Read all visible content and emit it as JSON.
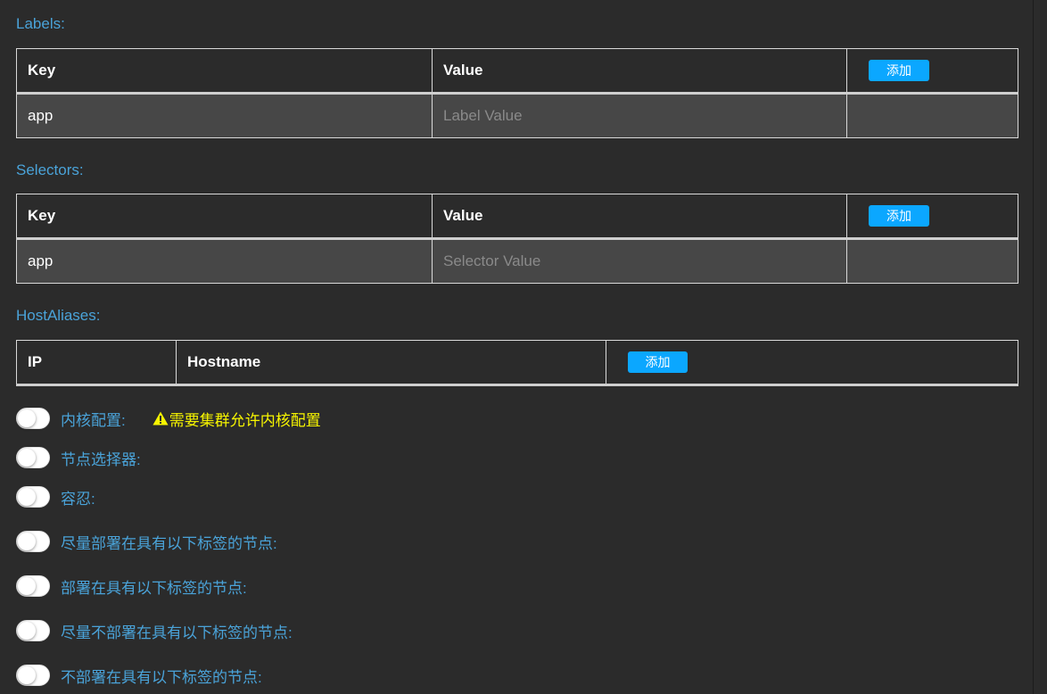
{
  "labels": {
    "title": "Labels:",
    "headers": {
      "key": "Key",
      "value": "Value"
    },
    "add_label": "添加",
    "row": {
      "key": "app",
      "value_placeholder": "Label Value"
    }
  },
  "selectors": {
    "title": "Selectors:",
    "headers": {
      "key": "Key",
      "value": "Value"
    },
    "add_label": "添加",
    "row": {
      "key": "app",
      "value_placeholder": "Selector Value"
    }
  },
  "host_aliases": {
    "title": "HostAliases:",
    "headers": {
      "ip": "IP",
      "hostname": "Hostname"
    },
    "add_label": "添加"
  },
  "toggles": [
    {
      "label": "内核配置:",
      "checked": false,
      "warning": "需要集群允许内核配置"
    },
    {
      "label": "节点选择器:",
      "checked": false
    },
    {
      "label": "容忍:",
      "checked": false
    },
    {
      "label": "尽量部署在具有以下标签的节点:",
      "checked": false
    },
    {
      "label": "部署在具有以下标签的节点:",
      "checked": false
    },
    {
      "label": "尽量不部署在具有以下标签的节点:",
      "checked": false
    },
    {
      "label": "不部署在具有以下标签的节点:",
      "checked": false
    }
  ],
  "colors": {
    "background": "#2b2b2b",
    "accent_label": "#4aa3d9",
    "button": "#0ba7ff",
    "warning": "#f7f500"
  }
}
